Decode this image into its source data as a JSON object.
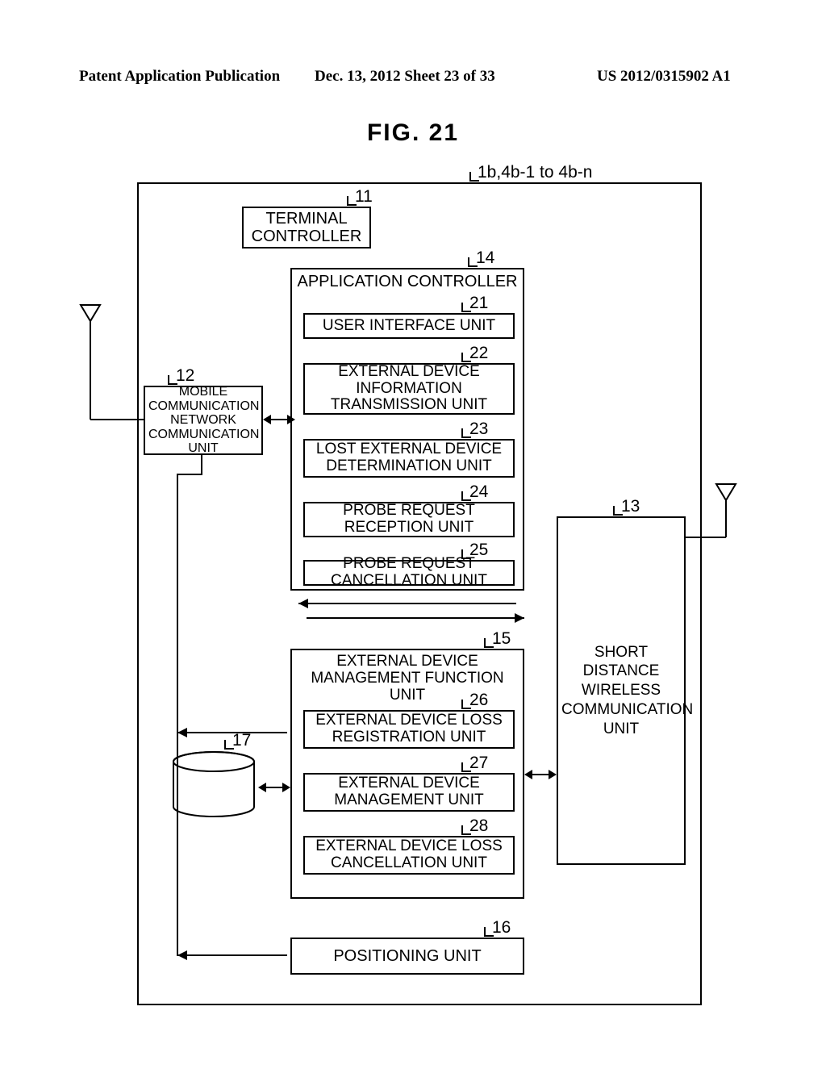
{
  "header": {
    "left": "Patent Application Publication",
    "mid": "Dec. 13, 2012  Sheet 23 of 33",
    "right": "US 2012/0315902 A1"
  },
  "figure_title": "FIG. 21",
  "labels": {
    "top_ref": "1b,4b-1 to 4b-n",
    "r11": "11",
    "r12": "12",
    "r13": "13",
    "r14": "14",
    "r15": "15",
    "r16": "16",
    "r17": "17",
    "r21": "21",
    "r22": "22",
    "r23": "23",
    "r24": "24",
    "r25": "25",
    "r26": "26",
    "r27": "27",
    "r28": "28"
  },
  "blocks": {
    "b11": "TERMINAL CONTROLLER",
    "b12": "MOBILE COMMUNICATION NETWORK COMMUNICATION UNIT",
    "b13": "SHORT DISTANCE WIRELESS COMMUNICATION UNIT",
    "b14": "APPLICATION CONTROLLER",
    "b15": "EXTERNAL DEVICE MANAGEMENT FUNCTION UNIT",
    "b16": "POSITIONING UNIT",
    "b21": "USER INTERFACE UNIT",
    "b22": "EXTERNAL DEVICE INFORMATION TRANSMISSION UNIT",
    "b23": "LOST EXTERNAL DEVICE DETERMINATION UNIT",
    "b24": "PROBE REQUEST RECEPTION UNIT",
    "b25": "PROBE REQUEST CANCELLATION UNIT",
    "b26": "EXTERNAL DEVICE LOSS REGISTRATION UNIT",
    "b27": "EXTERNAL DEVICE MANAGEMENT UNIT",
    "b28": "EXTERNAL DEVICE LOSS CANCELLATION UNIT"
  }
}
